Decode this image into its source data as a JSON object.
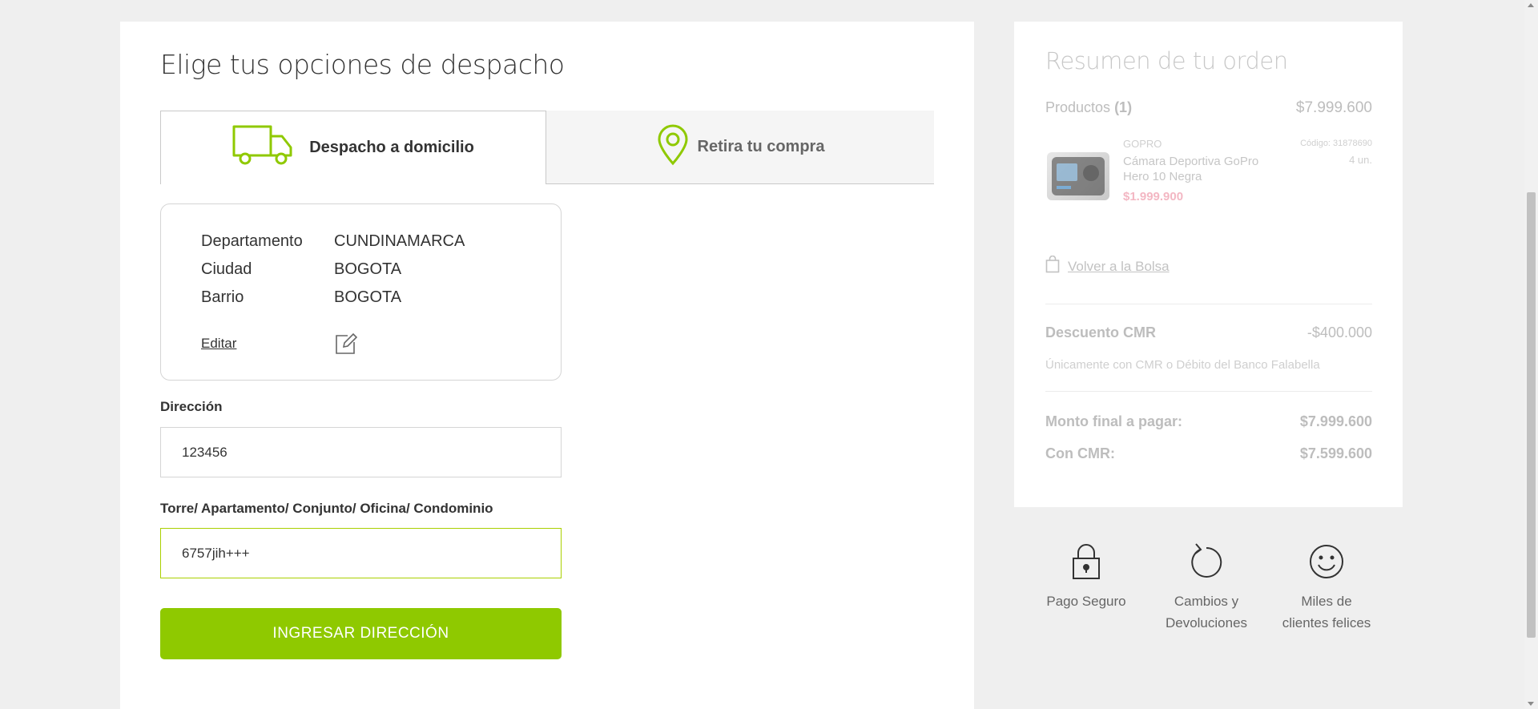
{
  "page": {
    "title": "Elige tus opciones de despacho"
  },
  "tabs": [
    {
      "label": "Despacho a domicilio",
      "icon": "truck-icon"
    },
    {
      "label": "Retira tu compra",
      "icon": "location-pin-icon"
    }
  ],
  "address": {
    "rows": [
      {
        "key": "Departamento",
        "value": "CUNDINAMARCA"
      },
      {
        "key": "Ciudad",
        "value": "BOGOTA"
      },
      {
        "key": "Barrio",
        "value": "BOGOTA"
      }
    ],
    "edit_label": "Editar"
  },
  "form": {
    "direccion_label": "Dirección",
    "direccion_value": "123456",
    "torre_label": "Torre/ Apartamento/ Conjunto/ Oficina/ Condominio",
    "torre_value": "6757jih+++",
    "submit_label": "INGRESAR DIRECCIÓN"
  },
  "summary": {
    "title": "Resumen de tu orden",
    "products_label": "Productos",
    "products_count": "(1)",
    "products_total": "$7.999.600",
    "product": {
      "brand": "GOPRO",
      "name": "Cámara Deportiva GoPro Hero 10 Negra",
      "price": "$1.999.900",
      "code": "Código: 31878690",
      "qty": "4 un."
    },
    "back_label": "Volver a la Bolsa",
    "discount_label": "Descuento CMR",
    "discount_value": "-$400.000",
    "discount_note": "Únicamente con CMR o Débito del Banco Falabella",
    "final_label": "Monto final a pagar:",
    "final_value": "$7.999.600",
    "cmr_label": "Con CMR:",
    "cmr_value": "$7.599.600"
  },
  "trust": [
    {
      "line1": "Pago Seguro",
      "line2": "",
      "icon": "padlock-icon"
    },
    {
      "line1": "Cambios y",
      "line2": "Devoluciones",
      "icon": "refresh-arrow-icon"
    },
    {
      "line1": "Miles de",
      "line2": "clientes felices",
      "icon": "smiley-icon"
    }
  ],
  "colors": {
    "accent": "#8fc900",
    "focus_border": "#aad000",
    "price_pink": "#f3b7c3"
  }
}
